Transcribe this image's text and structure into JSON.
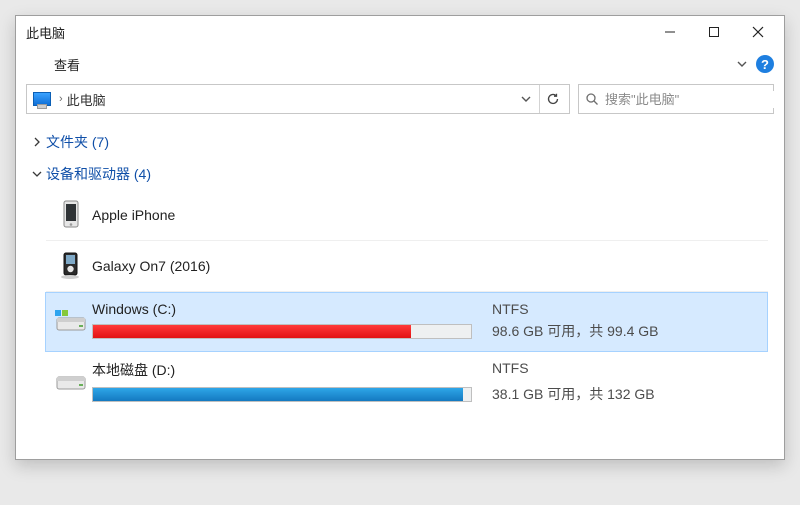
{
  "window": {
    "title": "此电脑"
  },
  "menu": {
    "view": "查看",
    "help_tooltip": "?"
  },
  "address": {
    "location": "此电脑",
    "separator": "›"
  },
  "search": {
    "placeholder": "搜索\"此电脑\""
  },
  "groups": {
    "folders": {
      "label": "文件夹 (7)",
      "expanded": false
    },
    "devices": {
      "label": "设备和驱动器 (4)",
      "expanded": true
    }
  },
  "devices": [
    {
      "name": "Apple iPhone",
      "type": "phone",
      "selected": false
    },
    {
      "name": "Galaxy On7 (2016)",
      "type": "media-player",
      "selected": false
    }
  ],
  "drives": [
    {
      "name": "Windows (C:)",
      "fs": "NTFS",
      "stats_text": "98.6 GB 可用，共 99.4 GB",
      "used_pct": 84,
      "bar_color": "red",
      "os_drive": true,
      "selected": true
    },
    {
      "name": "本地磁盘 (D:)",
      "fs": "NTFS",
      "stats_text": "38.1 GB 可用，共 132 GB",
      "used_pct": 98,
      "bar_color": "blue",
      "os_drive": false,
      "selected": false
    }
  ]
}
